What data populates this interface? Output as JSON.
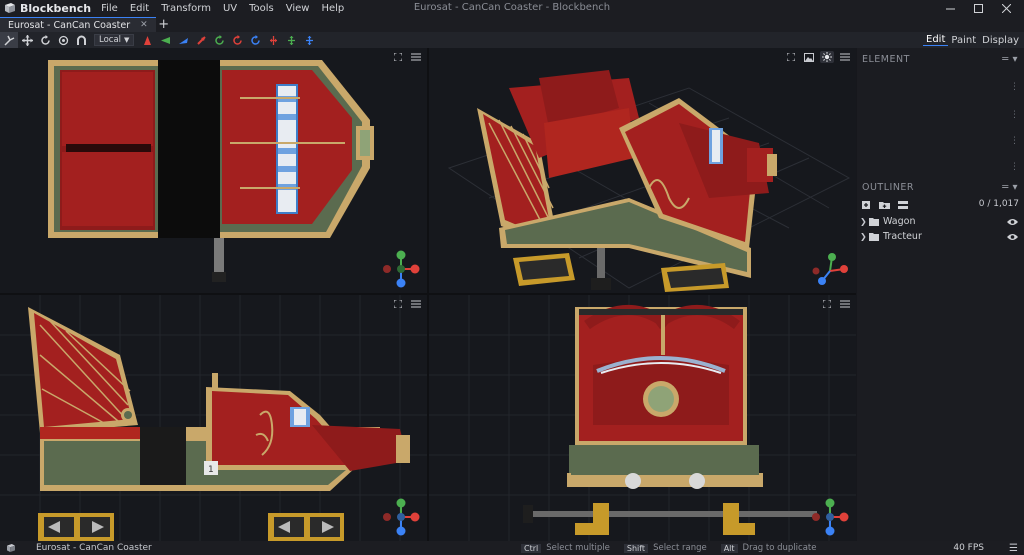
{
  "app": {
    "name": "Blockbench"
  },
  "menus": [
    "File",
    "Edit",
    "Transform",
    "UV",
    "Tools",
    "View",
    "Help"
  ],
  "window_title": "Eurosat - CanCan Coaster - Blockbench",
  "tab": {
    "label": "Eurosat - CanCan Coaster",
    "close": "✕",
    "add": "+"
  },
  "toolbar": {
    "space": "Local",
    "tools": [
      {
        "name": "move-tool",
        "color": "#d0d2d6"
      },
      {
        "name": "resize-tool",
        "color": "#d0d2d6"
      },
      {
        "name": "rotate-tool",
        "color": "#d0d2d6"
      },
      {
        "name": "pivot-tool",
        "color": "#d0d2d6"
      },
      {
        "name": "vertex-snap-tool",
        "color": "#d0d2d6"
      }
    ],
    "axis_buttons": [
      {
        "name": "move-x-red",
        "color": "#e0413a"
      },
      {
        "name": "move-y-green",
        "color": "#4caf50"
      },
      {
        "name": "move-z-blue",
        "color": "#3b82f6"
      },
      {
        "name": "flip-x-red",
        "color": "#e0413a"
      },
      {
        "name": "flip-y-green",
        "color": "#4caf50"
      },
      {
        "name": "flip-z-blue",
        "color": "#3b82f6"
      },
      {
        "name": "mirror-x-red",
        "color": "#e0413a"
      },
      {
        "name": "mirror-y-green",
        "color": "#4caf50"
      },
      {
        "name": "mirror-z-blue",
        "color": "#3b82f6"
      }
    ]
  },
  "modes": [
    "Edit",
    "Paint",
    "Display"
  ],
  "panels": {
    "element": {
      "title": "ELEMENT"
    },
    "outliner": {
      "title": "OUTLINER",
      "count": "0 / 1,017",
      "items": [
        {
          "label": "Wagon"
        },
        {
          "label": "Tracteur"
        }
      ]
    }
  },
  "status": {
    "project": "Eurosat - CanCan Coaster",
    "hints": [
      {
        "key": "Ctrl",
        "text": "Select multiple"
      },
      {
        "key": "Shift",
        "text": "Select range"
      },
      {
        "key": "Alt",
        "text": "Drag to duplicate"
      }
    ],
    "fps": "40 FPS"
  },
  "colors": {
    "accent": "#3b82f6",
    "model_red": "#a3201f",
    "model_gold": "#c9a86a",
    "model_green": "#5b6b4f"
  }
}
